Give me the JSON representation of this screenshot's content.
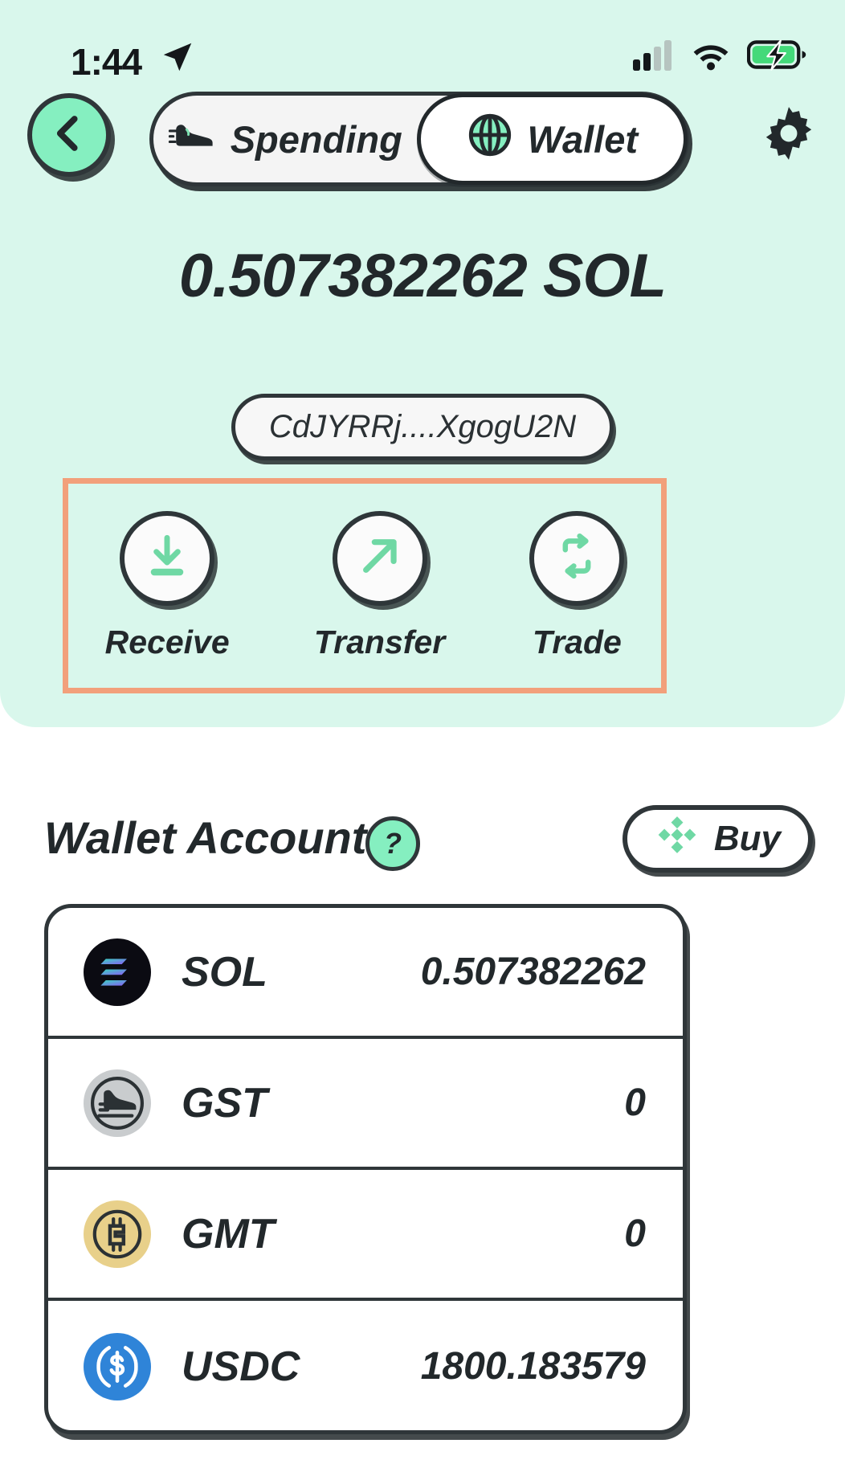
{
  "status_bar": {
    "time": "1:44",
    "location_icon": "location-arrow-icon",
    "cellular_icon": "cellular-signal-icon",
    "wifi_icon": "wifi-icon",
    "battery_icon": "battery-charging-icon"
  },
  "header": {
    "back_icon": "chevron-left-icon",
    "settings_icon": "gear-icon",
    "tabs": [
      {
        "label": "Spending",
        "icon": "sneaker-icon",
        "active": false
      },
      {
        "label": "Wallet",
        "icon": "globe-icon",
        "active": true
      }
    ]
  },
  "wallet": {
    "balance": "0.507382262 SOL",
    "address": "CdJYRRj....XgogU2N"
  },
  "actions": [
    {
      "label": "Receive",
      "icon": "download-arrow-icon"
    },
    {
      "label": "Transfer",
      "icon": "arrow-up-right-icon"
    },
    {
      "label": "Trade",
      "icon": "swap-arrows-icon"
    }
  ],
  "account_section": {
    "title": "Wallet Account",
    "help_label": "?",
    "buy_label": "Buy",
    "buy_icon": "binance-diamond-icon"
  },
  "tokens": [
    {
      "symbol": "SOL",
      "amount": "0.507382262",
      "logo": "solana-logo-icon"
    },
    {
      "symbol": "GST",
      "amount": "0",
      "logo": "gst-sneaker-logo-icon"
    },
    {
      "symbol": "GMT",
      "amount": "0",
      "logo": "gmt-coin-logo-icon"
    },
    {
      "symbol": "USDC",
      "amount": "1800.183579",
      "logo": "usdc-dollar-logo-icon"
    }
  ],
  "colors": {
    "mint_background": "#d9f7ec",
    "accent_green": "#85efc0",
    "icon_green": "#6fd8a4",
    "highlight_orange": "#f2a07b",
    "ink": "#22282b"
  }
}
